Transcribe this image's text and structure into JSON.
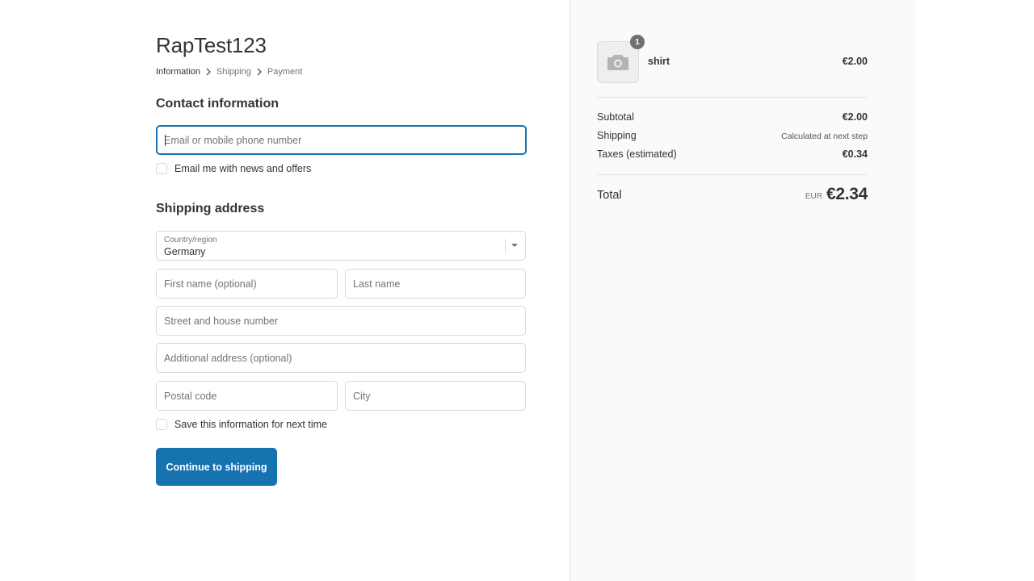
{
  "shop": {
    "name": "RapTest123"
  },
  "breadcrumb": {
    "items": [
      {
        "label": "Information",
        "active": true
      },
      {
        "label": "Shipping",
        "active": false
      },
      {
        "label": "Payment",
        "active": false
      }
    ]
  },
  "contact": {
    "title": "Contact information",
    "email_placeholder": "Email or mobile phone number",
    "email_value": "",
    "newsletter_label": "Email me with news and offers",
    "newsletter_checked": false
  },
  "shipping": {
    "title": "Shipping address",
    "country_label": "Country/region",
    "country_value": "Germany",
    "first_name_placeholder": "First name (optional)",
    "last_name_placeholder": "Last name",
    "street_placeholder": "Street and house number",
    "additional_placeholder": "Additional address (optional)",
    "postal_placeholder": "Postal code",
    "city_placeholder": "City",
    "save_info_label": "Save this information for next time",
    "save_info_checked": false
  },
  "actions": {
    "continue_label": "Continue to shipping"
  },
  "summary": {
    "product": {
      "name": "shirt",
      "price": "€2.00",
      "quantity": "1",
      "image_icon": "camera-icon"
    },
    "subtotal_label": "Subtotal",
    "subtotal_value": "€2.00",
    "shipping_label": "Shipping",
    "shipping_value": "Calculated at next step",
    "taxes_label": "Taxes (estimated)",
    "taxes_value": "€0.34",
    "total_label": "Total",
    "total_currency": "EUR",
    "total_value": "€2.34"
  },
  "colors": {
    "accent": "#1773b0",
    "summary_background": "#fafafa",
    "border": "#d9d9d9"
  }
}
